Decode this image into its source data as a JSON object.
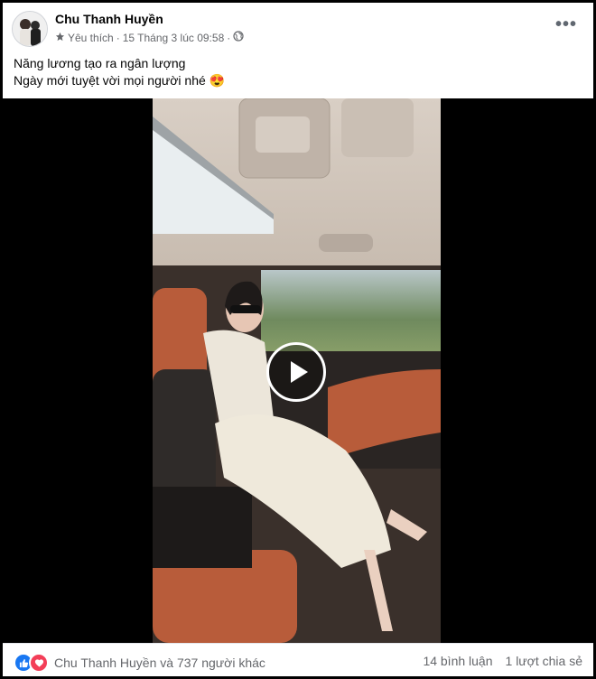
{
  "post": {
    "author": "Chu Thanh Huyền",
    "audience": "Yêu thích",
    "separator": "·",
    "timestamp": "15 Tháng 3 lúc 09:58",
    "text_line1": "Năng lương tạo ra ngân lượng",
    "text_line2": "Ngày mới tuyệt vời mọi người nhé",
    "emoji": "😍"
  },
  "footer": {
    "reactions_text": "Chu Thanh Huyền và 737 người khác",
    "comments": "14 bình luận",
    "shares": "1 lượt chia sẻ"
  },
  "colors": {
    "like_blue": "#1877f2",
    "love_red": "#f33e58",
    "seat_orange": "#b85c3a"
  },
  "icons": [
    "star-icon",
    "globe-icon",
    "more-options-icon",
    "play-icon",
    "like-reaction-icon",
    "love-reaction-icon"
  ]
}
